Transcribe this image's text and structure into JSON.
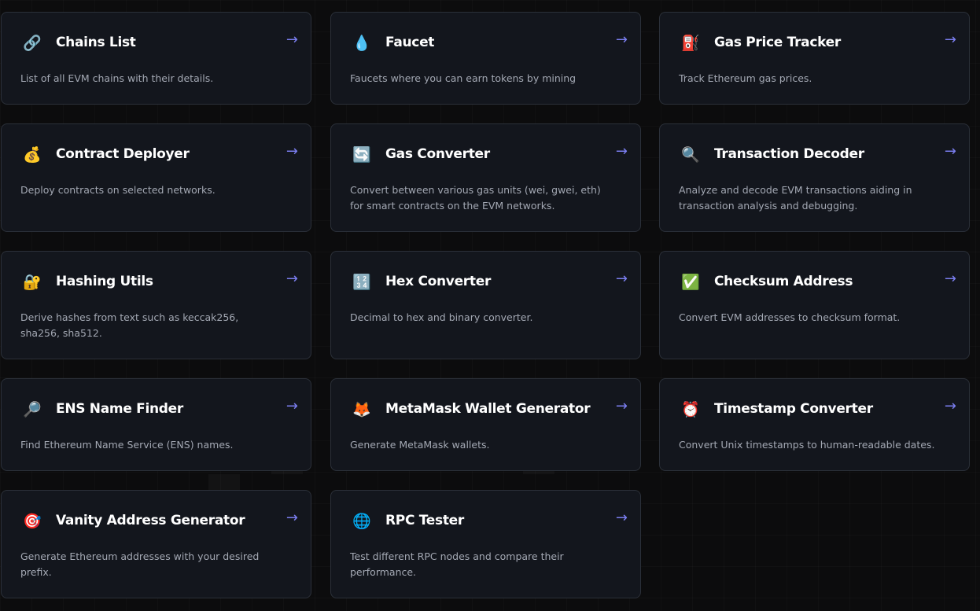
{
  "colors": {
    "background": "#0c0c0d",
    "card": "#13161d",
    "card_border": "#2b3039",
    "title": "#ffffff",
    "description": "#a3a8b3",
    "arrow": "#7b7ef0"
  },
  "tools": [
    {
      "title": "Chains List",
      "description": "List of all EVM chains with their details.",
      "icon": "link-icon",
      "glyph": "🔗",
      "arrow": "→"
    },
    {
      "title": "Faucet",
      "description": "Faucets where you can earn tokens by mining",
      "icon": "droplet-icon",
      "glyph": "💧",
      "arrow": "→"
    },
    {
      "title": "Gas Price Tracker",
      "description": "Track Ethereum gas prices.",
      "icon": "fuel-pump-icon",
      "glyph": "⛽",
      "arrow": "→"
    },
    {
      "title": "Contract Deployer",
      "description": "Deploy contracts on selected networks.",
      "icon": "money-bag-icon",
      "glyph": "💰",
      "arrow": "→"
    },
    {
      "title": "Gas Converter",
      "description": "Convert between various gas units (wei, gwei, eth) for smart contracts on the EVM networks.",
      "icon": "refresh-arrows-icon",
      "glyph": "🔄",
      "arrow": "→"
    },
    {
      "title": "Transaction Decoder",
      "description": "Analyze and decode EVM transactions aiding in transaction analysis and debugging.",
      "icon": "magnifying-glass-icon",
      "glyph": "🔍",
      "arrow": "→"
    },
    {
      "title": "Hashing Utils",
      "description": "Derive hashes from text such as keccak256, sha256, sha512.",
      "icon": "lock-key-icon",
      "glyph": "🔐",
      "arrow": "→"
    },
    {
      "title": "Hex Converter",
      "description": "Decimal to hex and binary converter.",
      "icon": "number-keypad-icon",
      "glyph": "🔢",
      "arrow": "→"
    },
    {
      "title": "Checksum Address",
      "description": "Convert EVM addresses to checksum format.",
      "icon": "check-mark-icon",
      "glyph": "✅",
      "arrow": "→"
    },
    {
      "title": "ENS Name Finder",
      "description": "Find Ethereum Name Service (ENS) names.",
      "icon": "magnifying-glass-right-icon",
      "glyph": "🔎",
      "arrow": "→"
    },
    {
      "title": "MetaMask Wallet Generator",
      "description": "Generate MetaMask wallets.",
      "icon": "fox-icon",
      "glyph": "🦊",
      "arrow": "→"
    },
    {
      "title": "Timestamp Converter",
      "description": "Convert Unix timestamps to human-readable dates.",
      "icon": "alarm-clock-icon",
      "glyph": "⏰",
      "arrow": "→"
    },
    {
      "title": "Vanity Address Generator",
      "description": "Generate Ethereum addresses with your desired prefix.",
      "icon": "target-icon",
      "glyph": "🎯",
      "arrow": "→"
    },
    {
      "title": "RPC Tester",
      "description": "Test different RPC nodes and compare their performance.",
      "icon": "globe-icon",
      "glyph": "🌐",
      "arrow": "→"
    }
  ]
}
